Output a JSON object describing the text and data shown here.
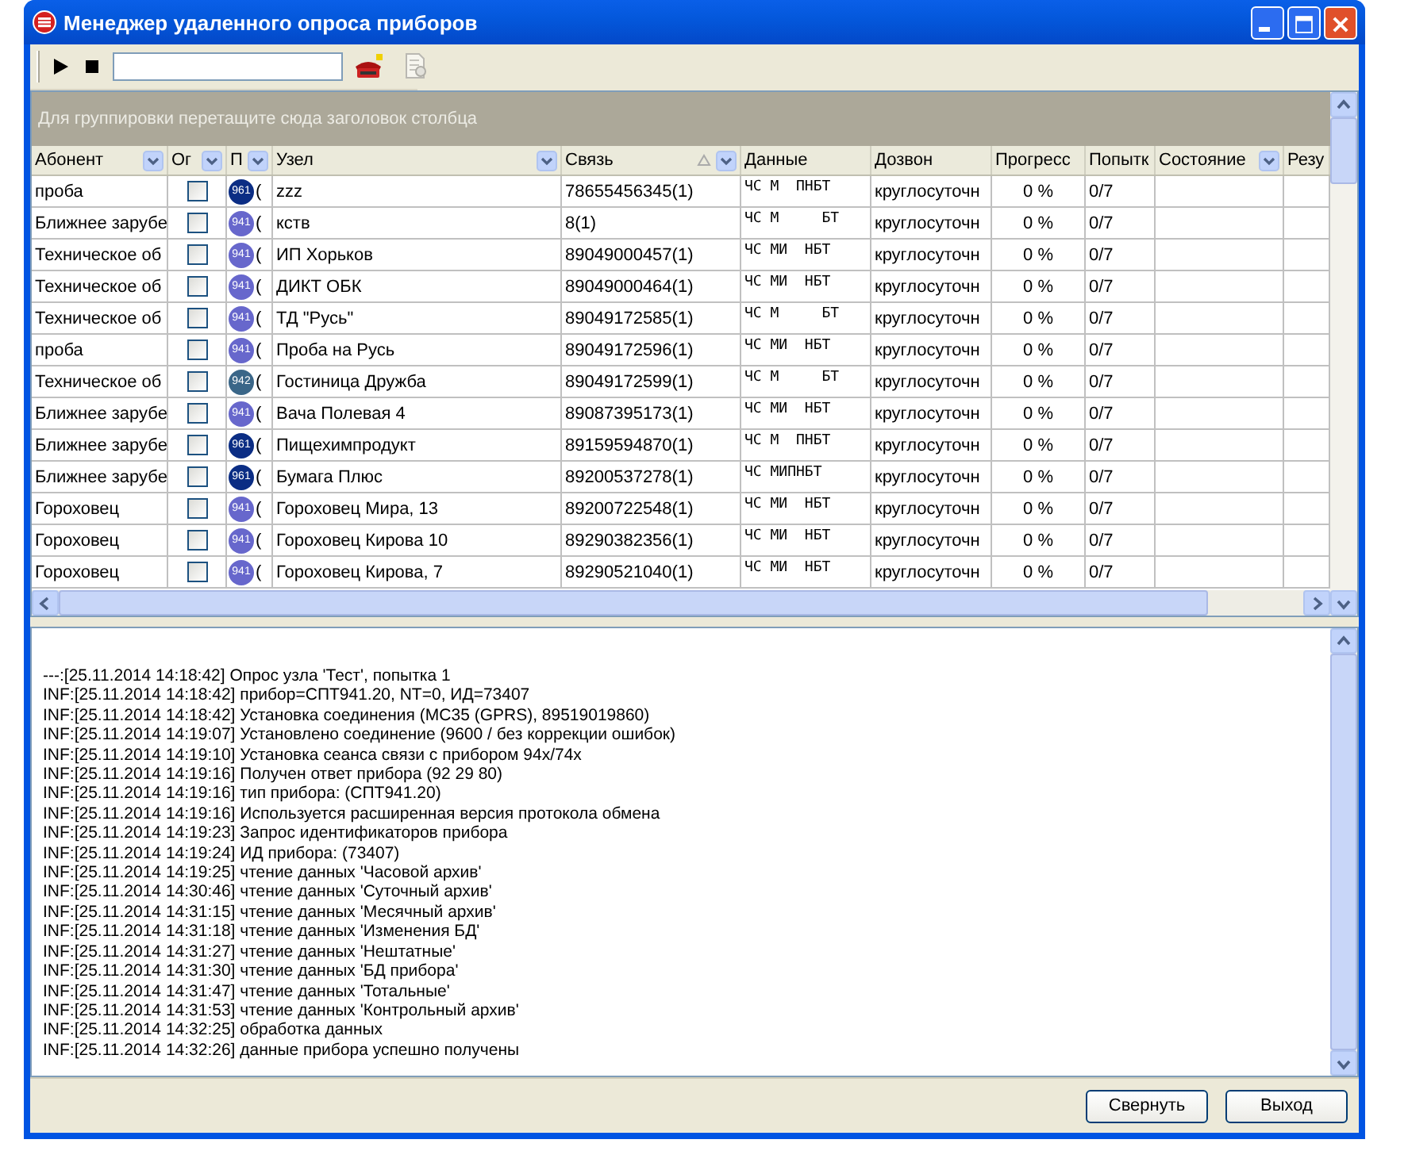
{
  "window": {
    "title": "Менеджер удаленного опроса приборов"
  },
  "group_panel": {
    "hint": "Для группировки перетащите сюда заголовок столбца"
  },
  "table": {
    "columns": [
      {
        "label": "Абонент",
        "filter": true,
        "sorted": false
      },
      {
        "label": "Ог",
        "filter": true,
        "sorted": false
      },
      {
        "label": "П",
        "filter": true,
        "sorted": false
      },
      {
        "label": "Узел",
        "filter": true,
        "sorted": false
      },
      {
        "label": "Связь",
        "filter": true,
        "sorted": true
      },
      {
        "label": "Данные",
        "filter": false,
        "sorted": false
      },
      {
        "label": "Дозвон",
        "filter": false,
        "sorted": false
      },
      {
        "label": "Прогресс",
        "filter": false,
        "sorted": false
      },
      {
        "label": "Попытк",
        "filter": false,
        "sorted": false
      },
      {
        "label": "Состояние",
        "filter": true,
        "sorted": false
      },
      {
        "label": "Резу",
        "filter": false,
        "sorted": false
      }
    ],
    "rows": [
      {
        "subscriber": "проба",
        "checked": false,
        "device": {
          "label": "961",
          "color": "#0b2d84"
        },
        "model": "(",
        "node": "zzz",
        "link": "78655456345(1)",
        "data": "ЧС М  ПНБТ",
        "dial": "круглосуточн",
        "progress": "0 %",
        "attempts": "0/7"
      },
      {
        "subscriber": "Ближнее зарубе",
        "checked": false,
        "device": {
          "label": "941",
          "color": "#6767cc"
        },
        "model": "(",
        "node": "кств",
        "link": "8(1)",
        "data": "ЧС М     БТ",
        "dial": "круглосуточн",
        "progress": "0 %",
        "attempts": "0/7"
      },
      {
        "subscriber": "Техническое об",
        "checked": false,
        "device": {
          "label": "941",
          "color": "#6767cc"
        },
        "model": "(",
        "node": "ИП Хорьков",
        "link": "89049000457(1)",
        "data": "ЧС МИ  НБТ",
        "dial": "круглосуточн",
        "progress": "0 %",
        "attempts": "0/7"
      },
      {
        "subscriber": "Техническое об",
        "checked": false,
        "device": {
          "label": "941",
          "color": "#6767cc"
        },
        "model": "(",
        "node": "ДИКТ ОБК",
        "link": "89049000464(1)",
        "data": "ЧС МИ  НБТ",
        "dial": "круглосуточн",
        "progress": "0 %",
        "attempts": "0/7"
      },
      {
        "subscriber": "Техническое об",
        "checked": false,
        "device": {
          "label": "941",
          "color": "#6767cc"
        },
        "model": "(",
        "node": "ТД \"Русь\"",
        "link": "89049172585(1)",
        "data": "ЧС М     БТ",
        "dial": "круглосуточн",
        "progress": "0 %",
        "attempts": "0/7"
      },
      {
        "subscriber": "проба",
        "checked": false,
        "device": {
          "label": "941",
          "color": "#6767cc"
        },
        "model": "(",
        "node": "Проба на Русь",
        "link": "89049172596(1)",
        "data": "ЧС МИ  НБТ",
        "dial": "круглосуточн",
        "progress": "0 %",
        "attempts": "0/7"
      },
      {
        "subscriber": "Техническое об",
        "checked": false,
        "device": {
          "label": "942",
          "color": "#3a6688"
        },
        "model": "(",
        "node": "Гостиница Дружба",
        "link": "89049172599(1)",
        "data": "ЧС М     БТ",
        "dial": "круглосуточн",
        "progress": "0 %",
        "attempts": "0/7"
      },
      {
        "subscriber": "Ближнее зарубе",
        "checked": false,
        "device": {
          "label": "941",
          "color": "#6767cc"
        },
        "model": "(",
        "node": "Вача Полевая 4",
        "link": "89087395173(1)",
        "data": "ЧС МИ  НБТ",
        "dial": "круглосуточн",
        "progress": "0 %",
        "attempts": "0/7"
      },
      {
        "subscriber": "Ближнее зарубе",
        "checked": false,
        "device": {
          "label": "961",
          "color": "#0b2d84"
        },
        "model": "(",
        "node": "Пищехимпродукт",
        "link": "89159594870(1)",
        "data": "ЧС М  ПНБТ",
        "dial": "круглосуточн",
        "progress": "0 %",
        "attempts": "0/7"
      },
      {
        "subscriber": "Ближнее зарубе",
        "checked": false,
        "device": {
          "label": "961",
          "color": "#0b2d84"
        },
        "model": "(",
        "node": "Бумага Плюс",
        "link": "89200537278(1)",
        "data": "ЧС МИПНБТ",
        "dial": "круглосуточн",
        "progress": "0 %",
        "attempts": "0/7"
      },
      {
        "subscriber": "Гороховец",
        "checked": false,
        "device": {
          "label": "941",
          "color": "#6767cc"
        },
        "model": "(",
        "node": "Гороховец Мира, 13",
        "link": "89200722548(1)",
        "data": "ЧС МИ  НБТ",
        "dial": "круглосуточн",
        "progress": "0 %",
        "attempts": "0/7"
      },
      {
        "subscriber": "Гороховец",
        "checked": false,
        "device": {
          "label": "941",
          "color": "#6767cc"
        },
        "model": "(",
        "node": "Гороховец Кирова 10",
        "link": "89290382356(1)",
        "data": "ЧС МИ  НБТ",
        "dial": "круглосуточн",
        "progress": "0 %",
        "attempts": "0/7"
      },
      {
        "subscriber": "Гороховец",
        "checked": false,
        "device": {
          "label": "941",
          "color": "#6767cc"
        },
        "model": "(",
        "node": "Гороховец Кирова, 7",
        "link": "89290521040(1)",
        "data": "ЧС МИ  НБТ",
        "dial": "круглосуточн",
        "progress": "0 %",
        "attempts": "0/7"
      }
    ]
  },
  "log": {
    "lines": [
      "---:[25.11.2014 14:18:42] Опрос узла 'Тест', попытка 1",
      "INF:[25.11.2014 14:18:42] прибор=СПТ941.20, NT=0, ИД=73407",
      "INF:[25.11.2014 14:18:42] Установка соединения (MC35 (GPRS), 89519019860)",
      "INF:[25.11.2014 14:19:07] Установлено соединение (9600 / без коррекции ошибок)",
      "INF:[25.11.2014 14:19:10] Установка сеанса связи с прибором 94x/74x",
      "INF:[25.11.2014 14:19:16] Получен ответ прибора (92 29 80)",
      "INF:[25.11.2014 14:19:16] тип прибора: (СПТ941.20)",
      "INF:[25.11.2014 14:19:16] Используется расширенная версия протокола обмена",
      "INF:[25.11.2014 14:19:23] Запрос идентификаторов прибора",
      "INF:[25.11.2014 14:19:24] ИД прибора: (73407)",
      "INF:[25.11.2014 14:19:25] чтение данных 'Часовой архив'",
      "INF:[25.11.2014 14:30:46] чтение данных 'Суточный архив'",
      "INF:[25.11.2014 14:31:15] чтение данных 'Месячный архив'",
      "INF:[25.11.2014 14:31:18] чтение данных 'Изменения БД'",
      "INF:[25.11.2014 14:31:27] чтение данных 'Нештатные'",
      "INF:[25.11.2014 14:31:30] чтение данных 'БД прибора'",
      "INF:[25.11.2014 14:31:47] чтение данных 'Тотальные'",
      "INF:[25.11.2014 14:31:53] чтение данных 'Контрольный архив'",
      "INF:[25.11.2014 14:32:25] обработка данных",
      "INF:[25.11.2014 14:32:26] данные прибора успешно получены"
    ]
  },
  "buttons": [
    {
      "label": "Свернуть"
    },
    {
      "label": "Выход"
    }
  ]
}
